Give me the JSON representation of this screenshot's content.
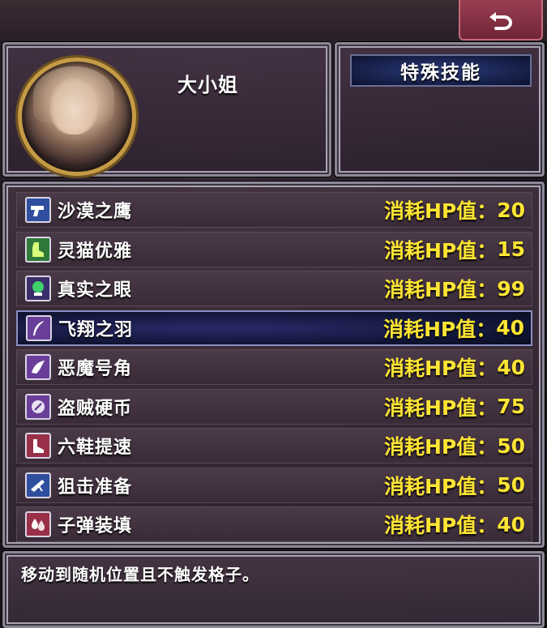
{
  "character": {
    "name": "大小姐"
  },
  "special_skill": {
    "header": "特殊技能"
  },
  "skills": [
    {
      "name": "沙漠之鹰",
      "cost_label": "消耗HP值：",
      "cost": "20",
      "icon": "pistol-icon",
      "icon_color": "#2f4f9e"
    },
    {
      "name": "灵猫优雅",
      "cost_label": "消耗HP值：",
      "cost": "15",
      "icon": "boot-icon",
      "icon_color": "#2f7a3a"
    },
    {
      "name": "真实之眼",
      "cost_label": "消耗HP值：",
      "cost": "99",
      "icon": "crystal-ball-icon",
      "icon_color": "#3a2f6a"
    },
    {
      "name": "飞翔之羽",
      "cost_label": "消耗HP值：",
      "cost": "40",
      "icon": "feather-icon",
      "icon_color": "#6a3f9a"
    },
    {
      "name": "恶魔号角",
      "cost_label": "消耗HP值：",
      "cost": "40",
      "icon": "horn-icon",
      "icon_color": "#6a3f9a"
    },
    {
      "name": "盗贼硬币",
      "cost_label": "消耗HP值：",
      "cost": "75",
      "icon": "coin-icon",
      "icon_color": "#6a3f9a"
    },
    {
      "name": "六鞋提速",
      "cost_label": "消耗HP值：",
      "cost": "50",
      "icon": "shoe-icon",
      "icon_color": "#9a2f4a"
    },
    {
      "name": "狙击准备",
      "cost_label": "消耗HP值：",
      "cost": "50",
      "icon": "rifle-icon",
      "icon_color": "#2f4f9e"
    },
    {
      "name": "子弹装填",
      "cost_label": "消耗HP值：",
      "cost": "40",
      "icon": "bullets-icon",
      "icon_color": "#9a2f4a"
    }
  ],
  "selected_index": 3,
  "description": "移动到随机位置且不触发格子。"
}
